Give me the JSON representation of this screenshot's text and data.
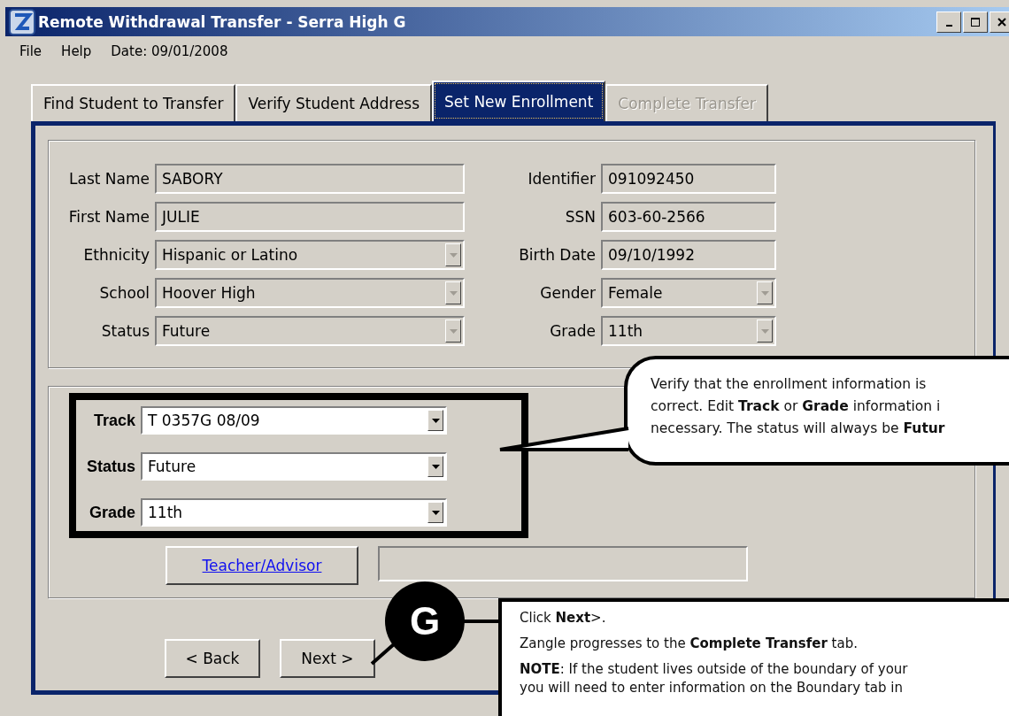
{
  "window": {
    "title": "Remote Withdrawal Transfer - Serra High G"
  },
  "menu": [
    {
      "label": "File"
    },
    {
      "label": "Help"
    }
  ],
  "date_label": "Date: 09/01/2008",
  "tabs": [
    {
      "label": "Find Student to Transfer",
      "selected": false,
      "disabled": false
    },
    {
      "label": "Verify Student Address",
      "selected": false,
      "disabled": false
    },
    {
      "label": "Set New Enrollment",
      "selected": true,
      "disabled": false
    },
    {
      "label": "Complete Transfer",
      "selected": false,
      "disabled": true
    }
  ],
  "student": {
    "left": [
      {
        "label": "Last Name",
        "value": "SABORY",
        "kind": "text"
      },
      {
        "label": "First Name",
        "value": "JULIE",
        "kind": "text"
      },
      {
        "label": "Ethnicity",
        "value": "Hispanic or Latino",
        "kind": "dropdown"
      },
      {
        "label": "School",
        "value": "Hoover High",
        "kind": "dropdown"
      },
      {
        "label": "Status",
        "value": "Future",
        "kind": "dropdown"
      }
    ],
    "right": [
      {
        "label": "Identifier",
        "value": "091092450",
        "kind": "text"
      },
      {
        "label": "SSN",
        "value": "603-60-2566",
        "kind": "text"
      },
      {
        "label": "Birth Date",
        "value": "09/10/1992",
        "kind": "text"
      },
      {
        "label": "Gender",
        "value": "Female",
        "kind": "dropdown"
      },
      {
        "label": "Grade",
        "value": "11th",
        "kind": "dropdown"
      }
    ]
  },
  "enrollment": {
    "fields": [
      {
        "label": "Track",
        "value": "T 0357G 08/09"
      },
      {
        "label": "Status",
        "value": "Future"
      },
      {
        "label": "Grade",
        "value": "11th"
      }
    ],
    "teacher_button": "Teacher/Advisor"
  },
  "buttons": [
    {
      "label": "< Back"
    },
    {
      "label": "Next >"
    }
  ],
  "step_marker": "G",
  "callouts": [
    {
      "kind": "bubble",
      "paragraphs": [
        [
          "Verify that the enrollment information is",
          "correct. Edit **Track** or **Grade** information i",
          "necessary. The status will always be **Futur**"
        ]
      ]
    },
    {
      "kind": "box",
      "paragraphs": [
        [
          "Click **Next**>."
        ],
        [
          "Zangle progresses to the **Complete Transfer** tab."
        ],
        [
          "**NOTE**: If the student lives outside of the boundary of your",
          "you will need to enter information on the Boundary tab in"
        ]
      ]
    }
  ]
}
